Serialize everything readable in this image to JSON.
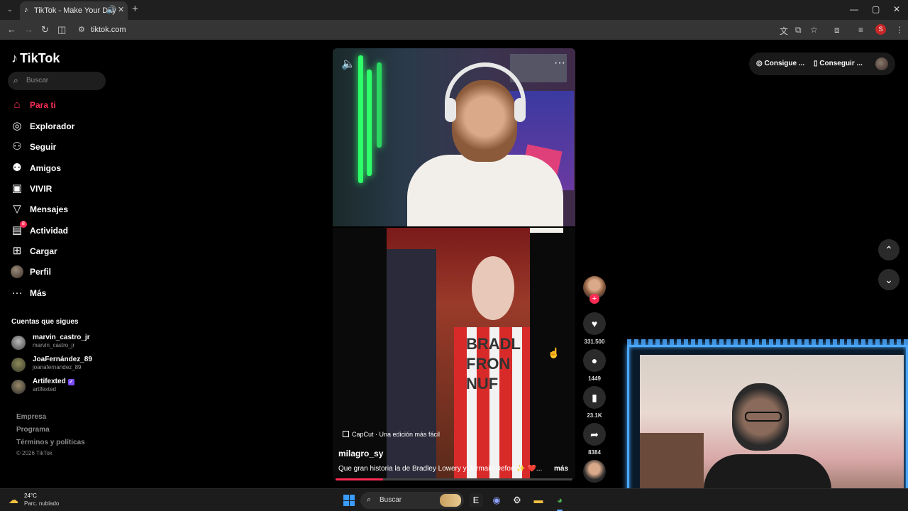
{
  "browser": {
    "tab_title": "TikTok - Make Your Day",
    "url": "tiktok.com",
    "profile_initial": "S"
  },
  "sidebar": {
    "logo": "TikTok",
    "search_placeholder": "Buscar",
    "nav": [
      {
        "label": "Para ti",
        "icon": "home-icon",
        "active": true
      },
      {
        "label": "Explorador",
        "icon": "compass-icon"
      },
      {
        "label": "Seguir",
        "icon": "following-icon"
      },
      {
        "label": "Amigos",
        "icon": "friends-icon"
      },
      {
        "label": "VIVIR",
        "icon": "live-icon"
      },
      {
        "label": "Mensajes",
        "icon": "messages-icon"
      },
      {
        "label": "Actividad",
        "icon": "activity-icon",
        "badge": "8"
      },
      {
        "label": "Cargar",
        "icon": "upload-icon"
      },
      {
        "label": "Perfil",
        "icon": "profile-avatar"
      },
      {
        "label": "Más",
        "icon": "more-dots-icon"
      }
    ],
    "following_title": "Cuentas que sigues",
    "following": [
      {
        "name": "marvin_castro_jr",
        "handle": "marvin_castro_jr"
      },
      {
        "name": "JoaFernández_89",
        "handle": "joanafernandez_89"
      },
      {
        "name": "Artifexted",
        "handle": "artifexted",
        "verified": true
      }
    ],
    "footer": [
      "Empresa",
      "Programa",
      "Términos y políticas"
    ],
    "copyright": "© 2026 TikTok"
  },
  "video": {
    "capcut_label": "CapCut · Una edición más fácil",
    "author": "milagro_sy",
    "description": "Que gran historia la de Bradley Lowery y Jermain Defoe ✨ ❤️...",
    "more_label": "más",
    "shirt_text": "BRADL FRON NUF",
    "progress": 0.2
  },
  "actions": {
    "likes": "331.500",
    "comments": "1449",
    "saves": "23.1K",
    "shares": "8384"
  },
  "topbar": {
    "btn1": "Consigue ...",
    "btn2": "Conseguir ..."
  },
  "taskbar": {
    "temperature": "24°C",
    "weather": "Parc. nublado",
    "search_label": "Buscar"
  },
  "colors": {
    "accent": "#fe2c55",
    "webcam_border": "#4aa8ff"
  }
}
